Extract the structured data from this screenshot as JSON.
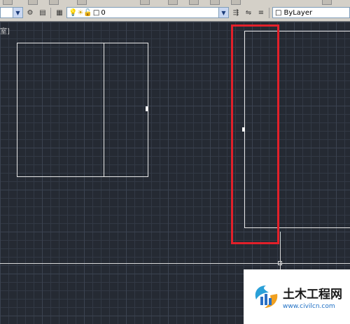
{
  "props_bar": {
    "layer_value": "0",
    "color_value": "ByLayer"
  },
  "canvas": {
    "viewport_label": "室]"
  },
  "watermark": {
    "site_name": "土木工程网",
    "site_url": "www.civilcn.com"
  },
  "colors": {
    "canvas_bg": "#252a33",
    "geometry": "#e8e8e8",
    "highlight": "#e2202a"
  }
}
